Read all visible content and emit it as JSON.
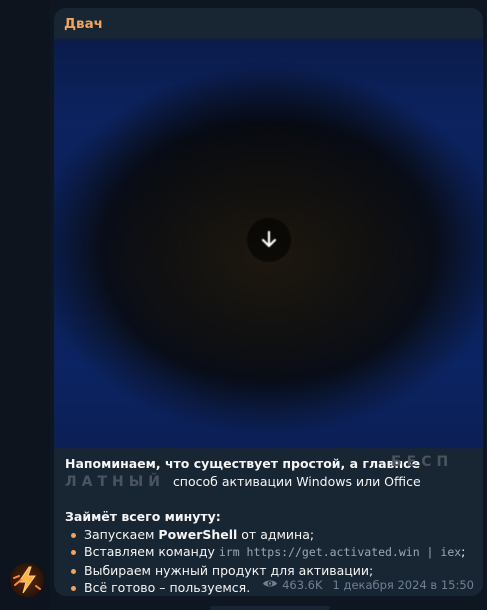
{
  "message": {
    "sender": "Двач",
    "text": {
      "intro_1": "Напоминаем, что существует простой, а главное",
      "watermark_1": "БЕСП",
      "watermark_2": "ЛАТНЫЙ",
      "intro_2": "способ активации Windows или Office",
      "subtitle": "Займёт всего минуту:",
      "steps": [
        {
          "before": "Запускаем ",
          "bold": "PowerShell",
          "after": " от админа;"
        },
        {
          "before": "Вставляем команду ",
          "code": "irm https://get.activated.win | iex",
          "after": ";"
        },
        {
          "before": "Выбираем нужный продукт для активации;"
        },
        {
          "before": "Всё готово – пользуемся."
        }
      ]
    },
    "views": "463.6K",
    "timestamp": "1 декабря 2024 в 15:50"
  },
  "icons": {
    "download": "arrow-down-icon",
    "views": "eye-icon",
    "avatar": "lightning-icon"
  },
  "colors": {
    "background": "#0e1621",
    "bubble": "#182533",
    "sender": "#f0a35a",
    "meta": "#6e8194"
  }
}
